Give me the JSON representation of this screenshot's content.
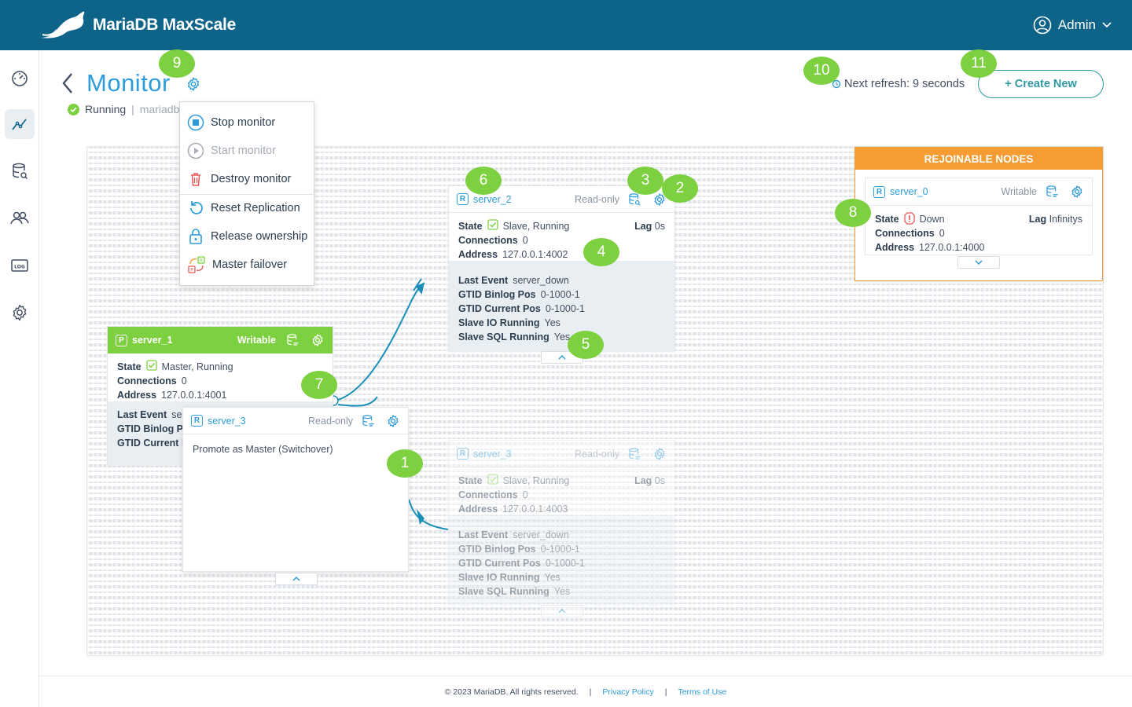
{
  "brand": {
    "name_bold": "MariaDB",
    "name_rest": "MaxScale"
  },
  "user": {
    "name": "Admin"
  },
  "nav": [
    "dashboard-icon",
    "monitor-icon",
    "query-editor-icon",
    "users-icon",
    "logs-icon",
    "settings-icon"
  ],
  "page": {
    "title": "Monitor",
    "status": "Running",
    "monitor_name": "mariadb",
    "refresh_text": "Next refresh: 9 seconds",
    "create_label": "+ Create New"
  },
  "menu": {
    "items": [
      {
        "label": "Stop monitor",
        "icon": "stop-icon",
        "enabled": true
      },
      {
        "label": "Start monitor",
        "icon": "play-icon",
        "enabled": false
      },
      {
        "label": "Destroy monitor",
        "icon": "trash-icon",
        "enabled": true
      },
      {
        "label": "Reset Replication",
        "icon": "reset-icon",
        "enabled": true
      },
      {
        "label": "Release ownership",
        "icon": "lock-icon",
        "enabled": true
      },
      {
        "label": "Master failover",
        "icon": "failover-icon",
        "enabled": true
      }
    ]
  },
  "labels": {
    "state": "State",
    "connections": "Connections",
    "address": "Address",
    "lag": "Lag",
    "last_event": "Last Event",
    "gtid_binlog": "GTID Binlog Pos",
    "gtid_current": "GTID Current Pos",
    "slave_io": "Slave IO Running",
    "slave_sql": "Slave SQL Running",
    "gtid_binlog_short": "GTID Binlog Po",
    "gtid_current_short": "GTID Current P",
    "last_event_trunc": "ser"
  },
  "nodes": {
    "server_1": {
      "name": "server_1",
      "type": "P",
      "role": "Writable",
      "state": "Master, Running",
      "connections": "0",
      "address": "127.0.0.1:4001"
    },
    "server_2": {
      "name": "server_2",
      "type": "R",
      "role": "Read-only",
      "state": "Slave, Running",
      "lag": "0s",
      "connections": "0",
      "address": "127.0.0.1:4002",
      "last_event": "server_down",
      "gtid_binlog": "0-1000-1",
      "gtid_current": "0-1000-1",
      "slave_io": "Yes",
      "slave_sql": "Yes"
    },
    "server_3": {
      "name": "server_3",
      "type": "R",
      "role": "Read-only",
      "state": "Slave, Running",
      "lag": "0s",
      "connections": "0",
      "address": "127.0.0.1:4003",
      "last_event": "server_down",
      "gtid_binlog": "0-1000-1",
      "gtid_current": "0-1000-1",
      "slave_io": "Yes",
      "slave_sql": "Yes"
    },
    "drag": {
      "name": "server_3",
      "type": "R",
      "role": "Read-only",
      "action": "Promote as Master (Switchover)"
    }
  },
  "rejoinable": {
    "title": "REJOINABLE NODES",
    "node": {
      "name": "server_0",
      "type": "R",
      "role": "Writable",
      "state": "Down",
      "lag": "Infinitys",
      "connections": "0",
      "address": "127.0.0.1:4000"
    }
  },
  "callouts": [
    "1",
    "2",
    "3",
    "4",
    "5",
    "6",
    "7",
    "8",
    "9",
    "10",
    "11"
  ],
  "footer": {
    "copyright": "© 2023 MariaDB. All rights reserved.",
    "sep": "|",
    "privacy": "Privacy Policy",
    "terms": "Terms of Use"
  },
  "colors": {
    "topbar": "#0e6488",
    "accent": "#2d9cdb",
    "master": "#7dd03f",
    "rejoin": "#f59c34",
    "teal": "#2f99a3"
  }
}
